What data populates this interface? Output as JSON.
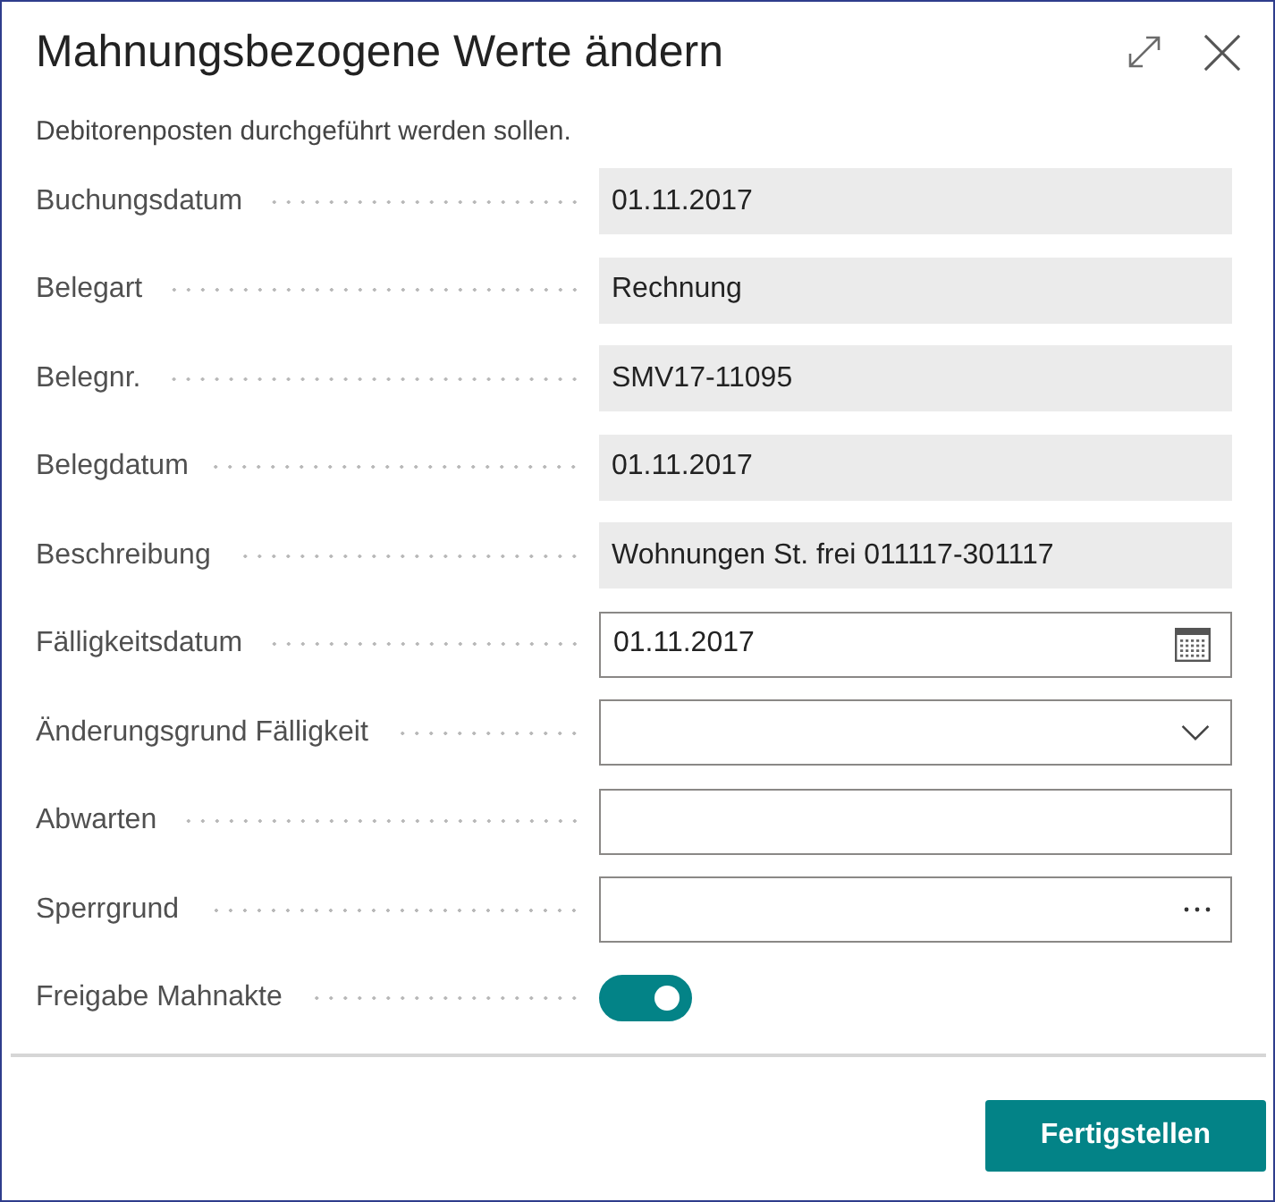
{
  "dialog": {
    "title": "Mahnungsbezogene Werte ändern",
    "intro": "Debitorenposten durchgeführt werden sollen.",
    "fields": [
      {
        "label": "Buchungsdatum",
        "kind": "readonly",
        "value": "01.11.2017"
      },
      {
        "label": "Belegart",
        "kind": "readonly",
        "value": "Rechnung"
      },
      {
        "label": "Belegnr.",
        "kind": "readonly",
        "value": "SMV17-11095"
      },
      {
        "label": "Belegdatum",
        "kind": "readonly",
        "value": "01.11.2017"
      },
      {
        "label": "Beschreibung",
        "kind": "readonly",
        "value": "Wohnungen St. frei 011117-301117"
      },
      {
        "label": "Fälligkeitsdatum",
        "kind": "date",
        "value": "01.11.2017"
      },
      {
        "label": "Änderungsgrund Fälligkeit",
        "kind": "dropdown"
      },
      {
        "label": "Abwarten",
        "kind": "text"
      },
      {
        "label": "Sperrgrund",
        "kind": "lookup"
      },
      {
        "label": "Freigabe Mahnakte",
        "kind": "toggle",
        "on": true
      }
    ],
    "buttons": [
      {
        "label": "Fertigstellen"
      }
    ]
  }
}
